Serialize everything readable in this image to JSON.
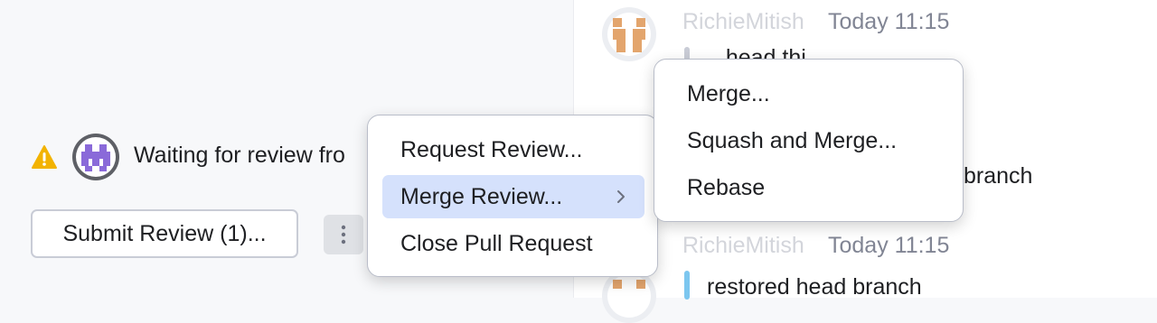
{
  "review_panel": {
    "waiting_text": "Waiting for review fro",
    "submit_button": "Submit Review (1)...",
    "more_button_icon": "more-vertical-icon",
    "warning_icon": "warning-icon",
    "reviewer_avatar": "reviewer-avatar"
  },
  "timeline": {
    "entry1": {
      "author": "RichieMitish",
      "time": "Today 11:15",
      "text": "...head thi...",
      "bar_color": "#c9ccd6"
    },
    "entry_middle": {
      "text_visible": "branch"
    },
    "entry2": {
      "author": "RichieMitish",
      "time": "Today 11:15",
      "text": "restored head branch",
      "bar_color": "#7cc6ef"
    }
  },
  "context_menu": {
    "items": [
      {
        "label": "Request Review...",
        "selected": false
      },
      {
        "label": "Merge Review...",
        "selected": true,
        "has_submenu": true
      },
      {
        "label": "Close Pull Request",
        "selected": false
      }
    ]
  },
  "merge_submenu": {
    "items": [
      {
        "label": "Merge..."
      },
      {
        "label": "Squash and Merge..."
      },
      {
        "label": "Rebase"
      }
    ]
  },
  "colors": {
    "accent_selection": "#d5e1fc",
    "warning": "#f2b300",
    "avatar_pixel_orange": "#e3a56d",
    "avatar_pixel_purple": "#8a6ad9"
  }
}
